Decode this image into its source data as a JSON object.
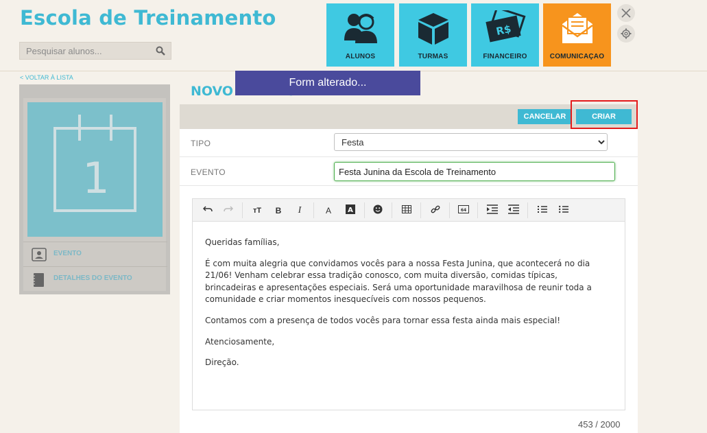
{
  "app": {
    "title": "Escola de Treinamento",
    "search_placeholder": "Pesquisar alunos..."
  },
  "nav": [
    {
      "label": "ALUNOS",
      "icon": "students-icon",
      "active": false
    },
    {
      "label": "TURMAS",
      "icon": "box-icon",
      "active": false
    },
    {
      "label": "FINANCEIRO",
      "icon": "money-icon",
      "active": false
    },
    {
      "label": "COMUNICAÇAO",
      "icon": "mail-icon",
      "active": true
    }
  ],
  "back_link": "< VOLTAR À LISTA",
  "sidebar": {
    "calendar_day": "1",
    "items": [
      {
        "label": "EVENTO",
        "icon": "profile-card-icon"
      },
      {
        "label": "DETALHES DO EVENTO",
        "icon": "notebook-icon"
      }
    ]
  },
  "page_title": "NOVO EVENTO",
  "toast": "Form alterado...",
  "actions": {
    "cancel": "CANCELAR",
    "create": "CRIAR"
  },
  "form": {
    "tipo_label": "TIPO",
    "tipo_value": "Festa",
    "evento_label": "EVENTO",
    "evento_value": "Festa Junina da Escola de Treinamento"
  },
  "editor": {
    "paragraphs": [
      "Queridas famílias,",
      "É com muita alegria que convidamos vocês para a nossa Festa Junina, que acontecerá no dia 21/06! Venham celebrar essa tradição conosco, com muita diversão, comidas típicas, brincadeiras e apresentações especiais. Será uma oportunidade maravilhosa de reunir toda a comunidade e criar momentos inesquecíveis com nossos pequenos.",
      "Contamos com a presença de todos vocês para tornar essa festa ainda mais especial!",
      "Atenciosamente,",
      "Direção."
    ],
    "char_count": "453 / 2000"
  },
  "colors": {
    "brand": "#3fb9d3",
    "tile": "#3fc9e2",
    "tile_active": "#f7941d",
    "toast": "#4a4a9c",
    "highlight": "#e41b1b"
  }
}
